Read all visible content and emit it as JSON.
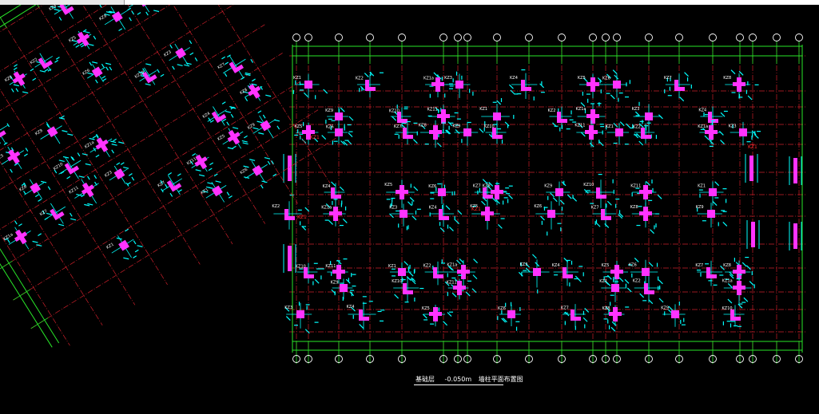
{
  "caption": {
    "label": "基础层",
    "elevation": "-0.050m",
    "title": "墙柱平面布置图"
  },
  "colors": {
    "background": "#000000",
    "axis": "#ffffff",
    "grid": "#cc1f2a",
    "dims": "#29e629",
    "column": "#ff33ff",
    "rebar": "#00ffff",
    "label": "#ffffff",
    "highlight": "#ff2a2a"
  },
  "marks": [
    "KZ1",
    "KZ2",
    "KZ1a",
    "KZ3",
    "KZ4",
    "KZ5",
    "KZ6",
    "KZ7",
    "KZ8",
    "KZ9",
    "KZ10",
    "KZ11"
  ]
}
